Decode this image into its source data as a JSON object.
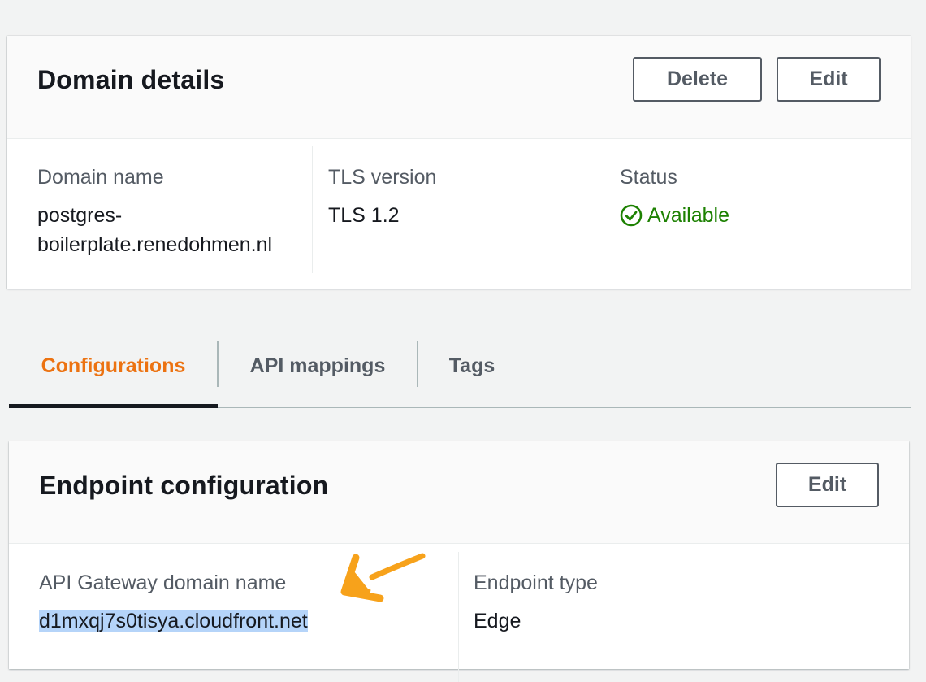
{
  "domain_panel": {
    "title": "Domain details",
    "delete_label": "Delete",
    "edit_label": "Edit",
    "fields": {
      "domain_name_label": "Domain name",
      "domain_name_line1": "postgres-",
      "domain_name_line2": "boilerplate.renedohmen.nl",
      "tls_label": "TLS version",
      "tls_value": "TLS 1.2",
      "status_label": "Status",
      "status_value": "Available"
    }
  },
  "tabs": [
    {
      "label": "Configurations",
      "active": true
    },
    {
      "label": "API mappings",
      "active": false
    },
    {
      "label": "Tags",
      "active": false
    }
  ],
  "endpoint_panel": {
    "title": "Endpoint configuration",
    "edit_label": "Edit",
    "fields": {
      "gateway_label": "API Gateway domain name",
      "gateway_value": "d1mxqj7s0tisya.cloudfront.net",
      "endpoint_type_label": "Endpoint type",
      "endpoint_type_value": "Edge"
    }
  },
  "icons": {
    "status": "check-circle-icon",
    "annotation": "hand-drawn-arrow-icon"
  },
  "colors": {
    "accent": "#ec7211",
    "success": "#1d8102",
    "selection": "#b5d4f9",
    "annotation_arrow": "#f7a21b"
  }
}
